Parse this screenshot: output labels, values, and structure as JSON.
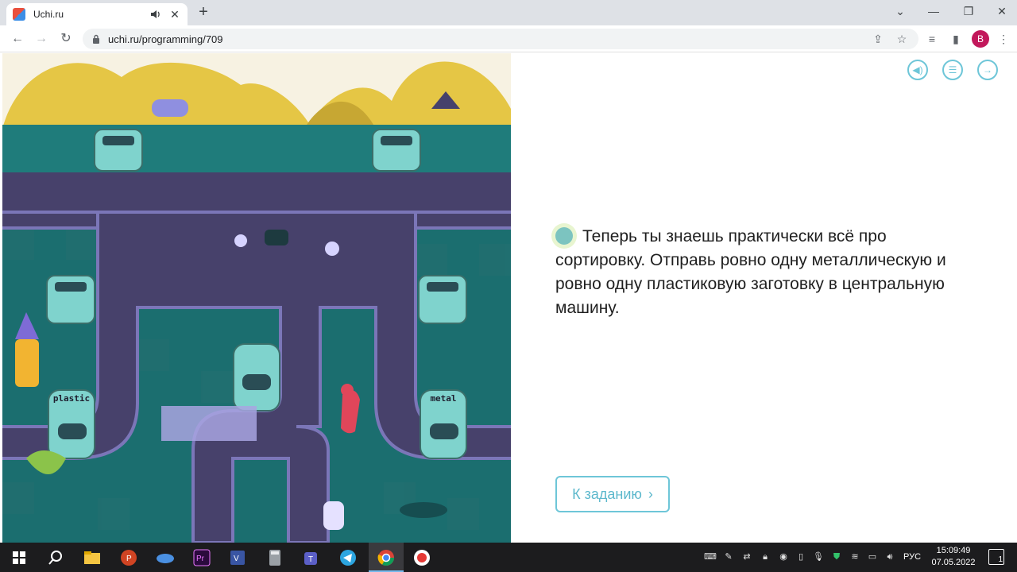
{
  "browser": {
    "tab_title": "Uchi.ru",
    "tab_close": "✕",
    "new_tab": "+",
    "url": "uchi.ru/programming/709",
    "profile_initial": "B",
    "controls": {
      "minimize": "—",
      "restore": "❐",
      "close": "✕",
      "tab_search": "⌄"
    }
  },
  "page": {
    "task_text": "Теперь ты знаешь практически всё про сортировку. Отправь ровно одну металлическую и ровно одну пластиковую заготовку в центральную машину.",
    "go_button_label": "К заданию",
    "go_button_chevron": "›"
  },
  "game": {
    "bin_left_label": "plastic",
    "bin_right_label": "metal"
  },
  "taskbar": {
    "language": "РУС",
    "time": "15:09:49",
    "date": "07.05.2022",
    "notification_count": "1"
  },
  "colors": {
    "accent": "#6ec6d8",
    "game_bg": "#1b6e6f",
    "conveyor": "#47416b",
    "hills": "#e5c645"
  }
}
